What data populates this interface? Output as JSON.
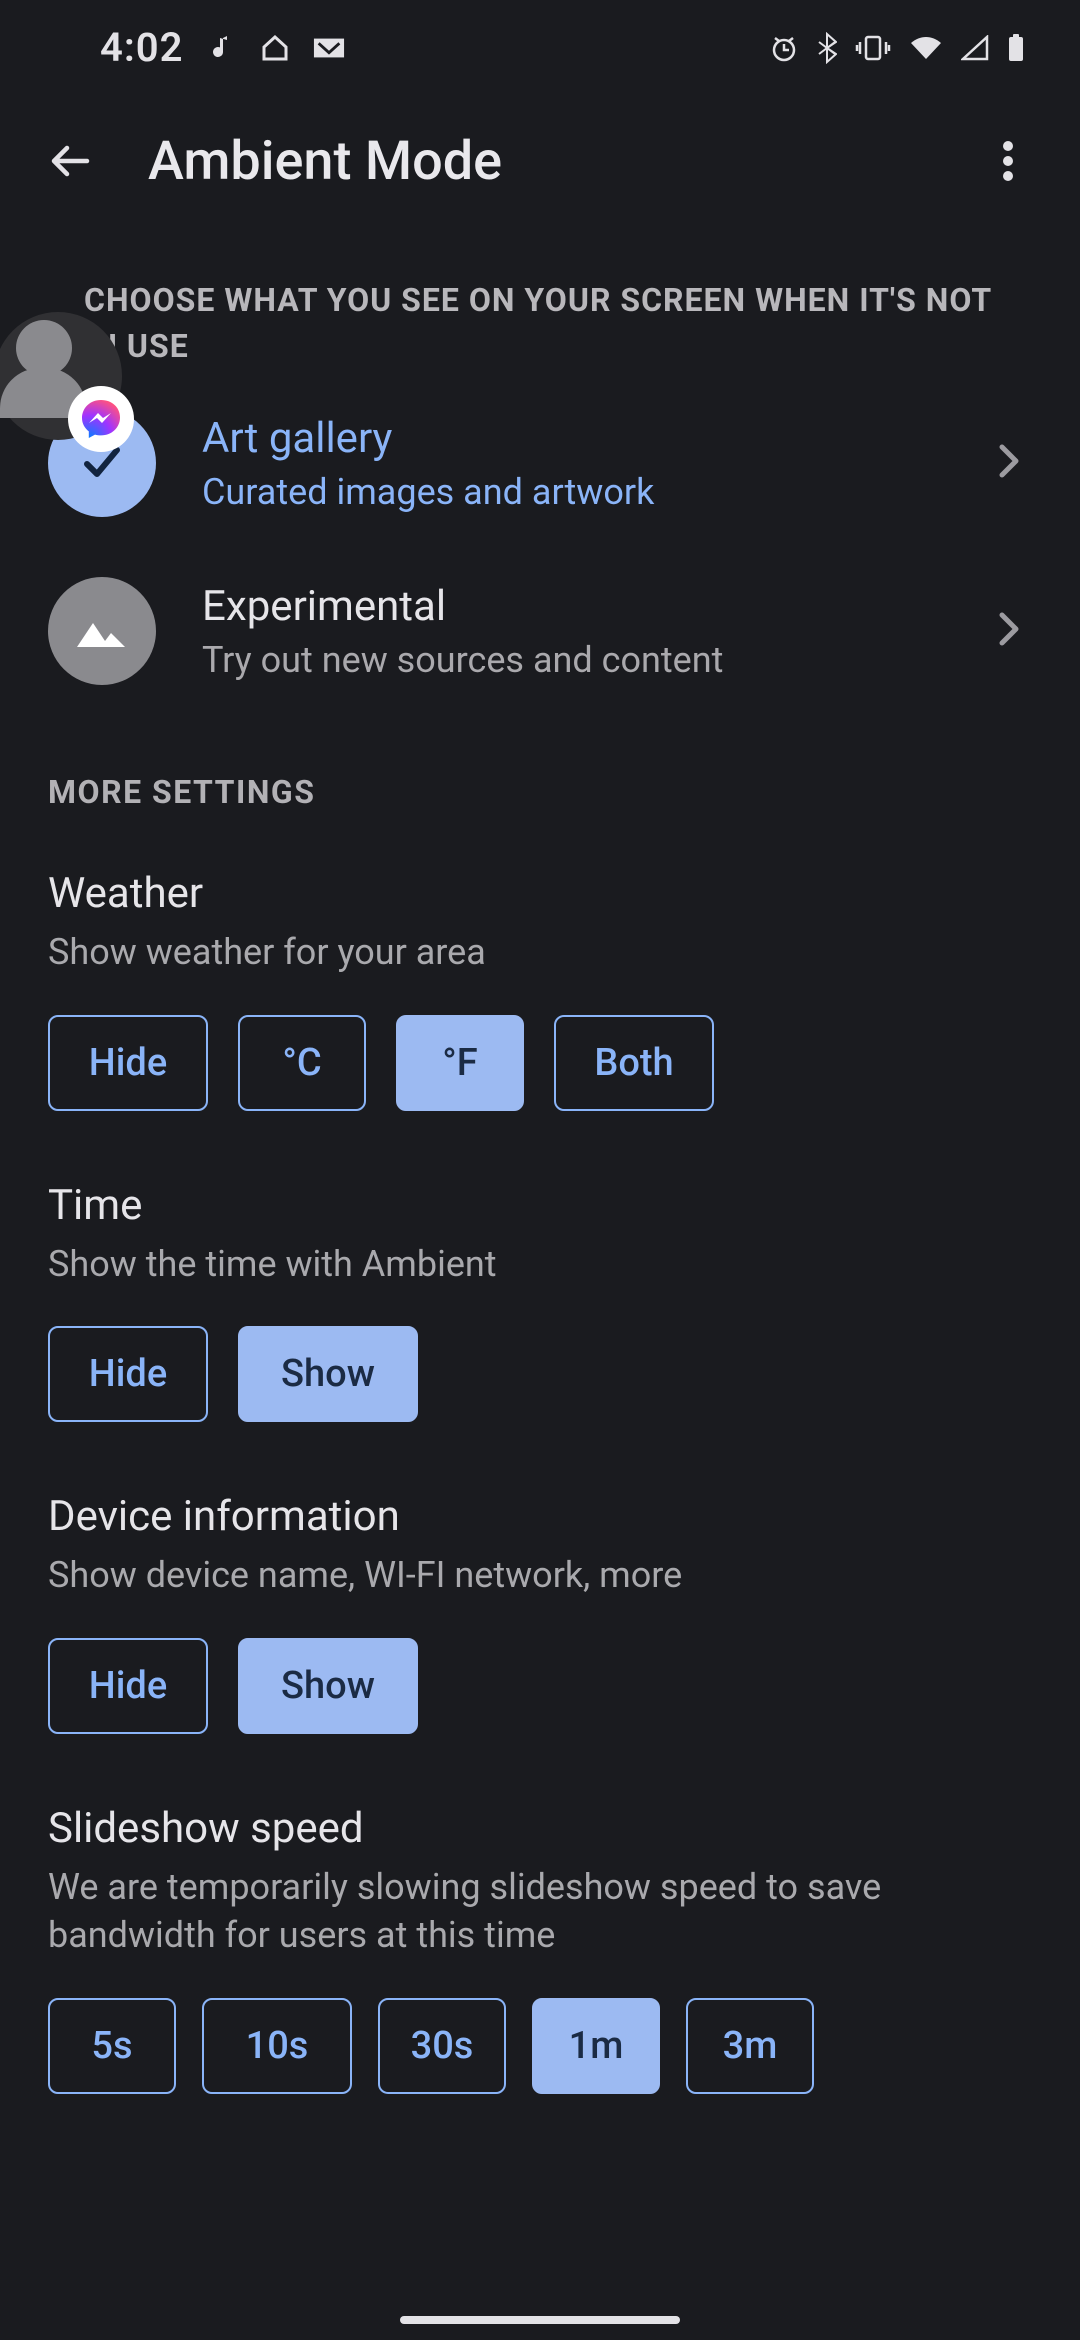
{
  "status": {
    "clock": "4:02"
  },
  "app_bar": {
    "title": "Ambient Mode"
  },
  "description": "CHOOSE WHAT YOU SEE ON YOUR SCREEN WHEN IT'S NOT IN USE",
  "modes": [
    {
      "title": "Art gallery",
      "sub": "Curated images and artwork"
    },
    {
      "title": "Experimental",
      "sub": "Try out new sources and content"
    }
  ],
  "more_settings_label": "MORE SETTINGS",
  "weather": {
    "title": "Weather",
    "sub": "Show weather for your area",
    "options": [
      "Hide",
      "°C",
      "°F",
      "Both"
    ],
    "selected_index": 2
  },
  "time": {
    "title": "Time",
    "sub": "Show the time with Ambient",
    "options": [
      "Hide",
      "Show"
    ],
    "selected_index": 1
  },
  "device_info": {
    "title": "Device information",
    "sub": "Show device name, WI-FI network, more",
    "options": [
      "Hide",
      "Show"
    ],
    "selected_index": 1
  },
  "slideshow": {
    "title": "Slideshow speed",
    "sub": "We are temporarily slowing slideshow speed to save bandwidth for users at this time",
    "options": [
      "5s",
      "10s",
      "30s",
      "1m",
      "3m"
    ],
    "selected_index": 3
  }
}
